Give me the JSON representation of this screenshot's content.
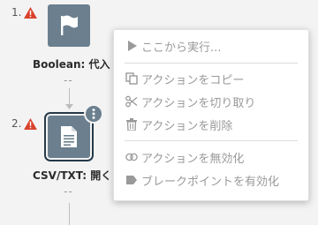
{
  "steps": [
    {
      "number": "1.",
      "label": "Boolean: 代入",
      "dash": "--",
      "icon": "flag-icon"
    },
    {
      "number": "2.",
      "label": "CSV/TXT: 開く",
      "dash": "--",
      "icon": "document-icon"
    }
  ],
  "more_button_icon": "vertical-ellipsis-icon",
  "context_menu": {
    "run_from_here": "ここから実行...",
    "copy_action": "アクションをコピー",
    "cut_action": "アクションを切り取り",
    "delete_action": "アクションを削除",
    "disable_action": "アクションを無効化",
    "enable_breakpoint": "ブレークポイントを有効化"
  },
  "colors": {
    "tile": "#6b7f8e",
    "warning": "#d9412b",
    "menu_text": "#9a9a9a"
  }
}
